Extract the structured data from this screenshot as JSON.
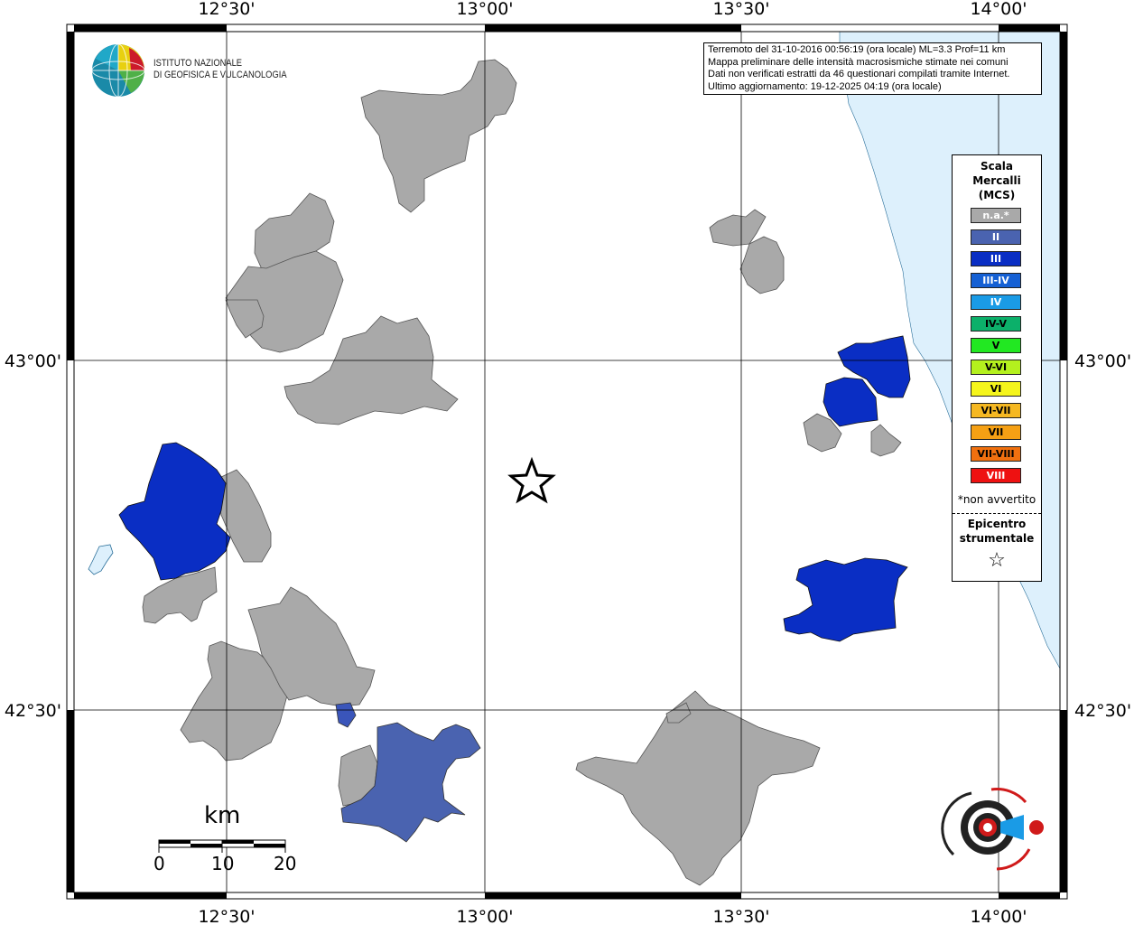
{
  "info": {
    "line1": "Terremoto del 31-10-2016 00:56:19 (ora locale) ML=3.3 Prof=11 km",
    "line2": "Mappa preliminare delle intensità macrosismiche stimate nei comuni",
    "line3": "Dati non verificati estratti da 46 questionari compilati tramite Internet.",
    "line4": "Ultimo aggiornamento: 19-12-2025 04:19 (ora locale)"
  },
  "axes": {
    "top": [
      "12°30'",
      "13°00'",
      "13°30'",
      "14°00'"
    ],
    "bottom": [
      "12°30'",
      "13°00'",
      "13°30'",
      "14°00'"
    ],
    "left": [
      "43°00'",
      "42°30'"
    ],
    "right": [
      "43°00'",
      "42°30'"
    ]
  },
  "institute": {
    "line1": "ISTITUTO NAZIONALE",
    "line2": "DI GEOFISICA E VULCANOLOGIA"
  },
  "legend": {
    "title_line1": "Scala",
    "title_line2": "Mercalli",
    "title_line3": "(MCS)",
    "items": [
      {
        "label": "n.a.*",
        "color": "#a9a9a9",
        "text": "#ffffff"
      },
      {
        "label": "II",
        "color": "#4a63b0",
        "text": "#ffffff"
      },
      {
        "label": "III",
        "color": "#0a2ec4",
        "text": "#ffffff"
      },
      {
        "label": "III-IV",
        "color": "#1560d4",
        "text": "#ffffff"
      },
      {
        "label": "IV",
        "color": "#1a9be6",
        "text": "#ffffff"
      },
      {
        "label": "IV-V",
        "color": "#0cb06a",
        "text": "#000000"
      },
      {
        "label": "V",
        "color": "#22e822",
        "text": "#000000"
      },
      {
        "label": "V-VI",
        "color": "#b4f01e",
        "text": "#000000"
      },
      {
        "label": "VI",
        "color": "#f5f51c",
        "text": "#000000"
      },
      {
        "label": "VI-VII",
        "color": "#f5b822",
        "text": "#000000"
      },
      {
        "label": "VII",
        "color": "#f5a014",
        "text": "#000000"
      },
      {
        "label": "VII-VIII",
        "color": "#f0700f",
        "text": "#000000"
      },
      {
        "label": "VIII",
        "color": "#ee1111",
        "text": "#ffffff"
      }
    ],
    "note": "*non avvertito",
    "epicenter_line1": "Epicentro",
    "epicenter_line2": "strumentale",
    "star": "☆"
  },
  "scale_bar": {
    "unit": "km",
    "ticks": [
      "0",
      "10",
      "20"
    ]
  },
  "colors": {
    "not_felt": "#a9a9a9",
    "II": "#4a63b0",
    "III": "#0a2ec4",
    "sea": "#ddf0fc"
  }
}
